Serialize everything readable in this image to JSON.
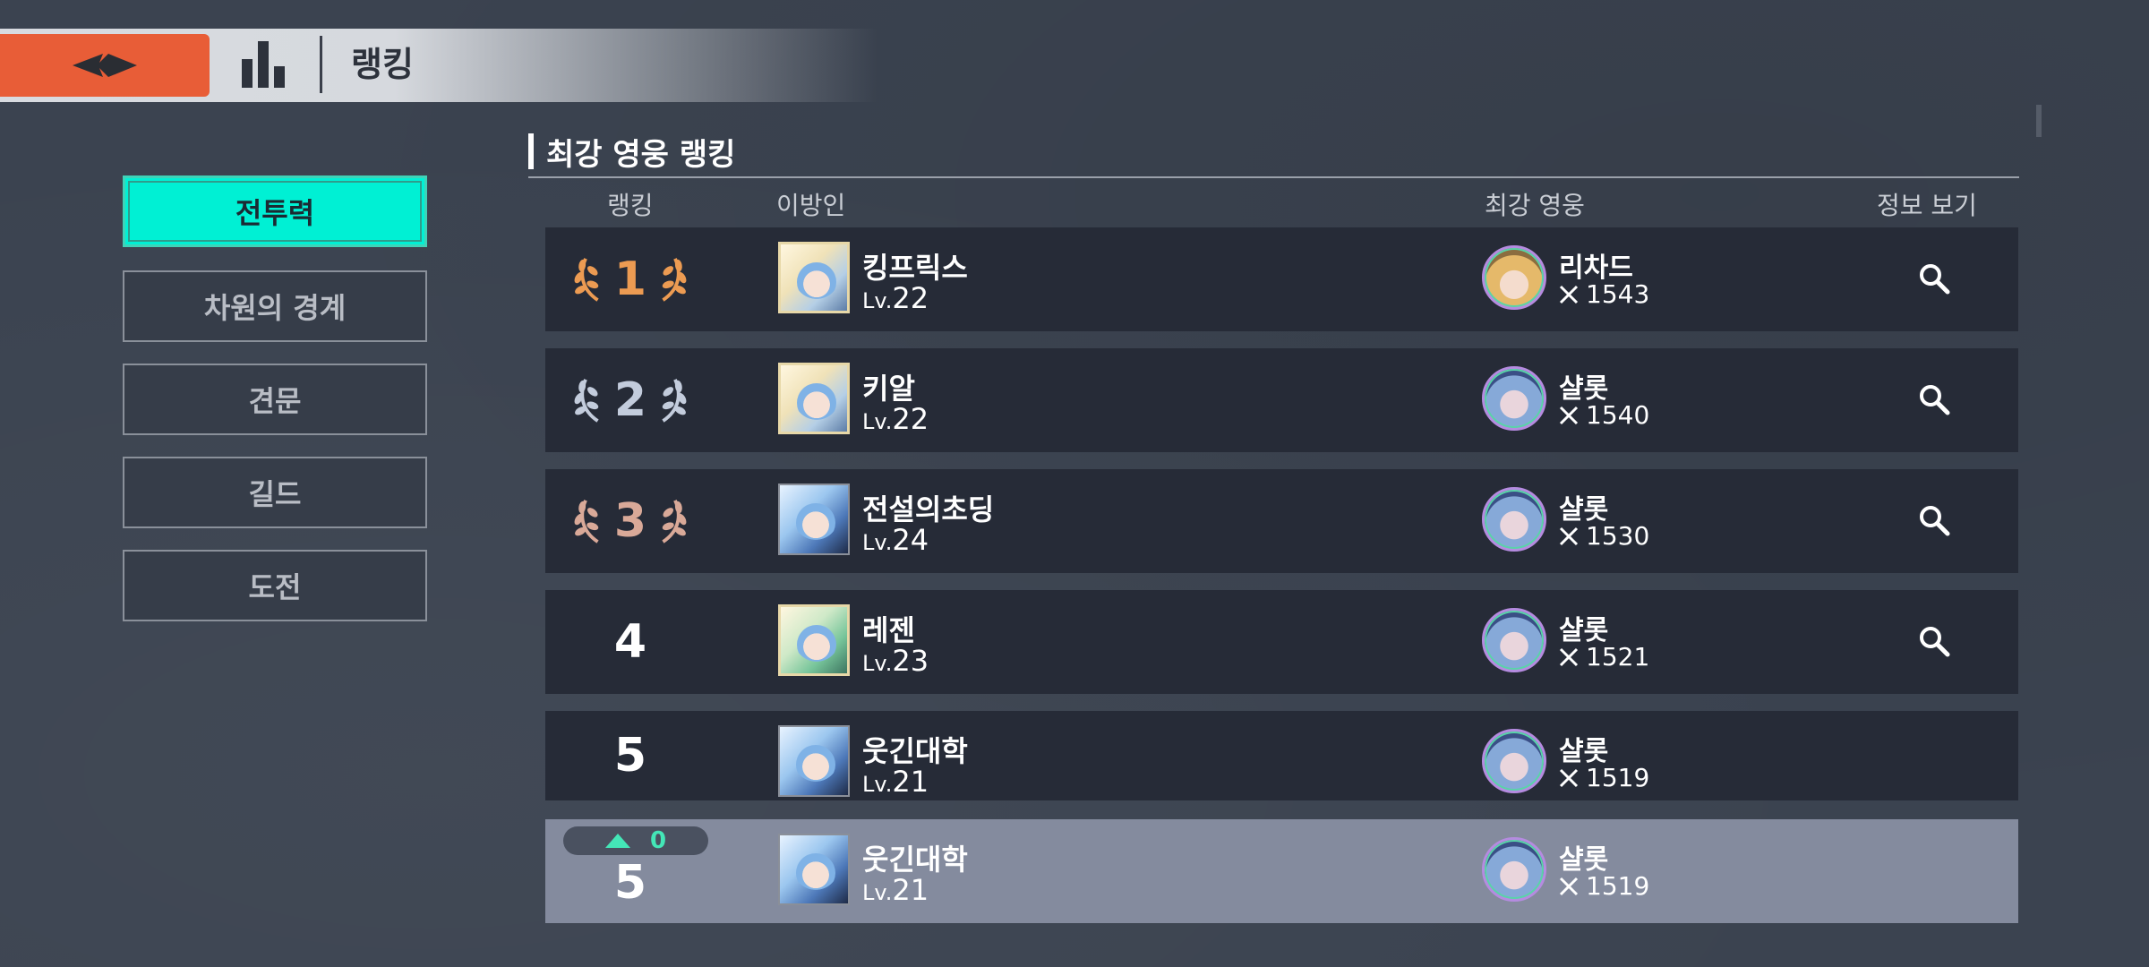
{
  "header": {
    "title": "랭킹",
    "back_icon": "back-arrow-icon",
    "ranking_icon": "bar-chart-icon",
    "accent_color": "#e85d37"
  },
  "sidebar": {
    "items": [
      {
        "label": "전투력",
        "active": true
      },
      {
        "label": "차원의 경계",
        "active": false
      },
      {
        "label": "견문",
        "active": false
      },
      {
        "label": "길드",
        "active": false
      },
      {
        "label": "도전",
        "active": false
      }
    ],
    "active_color": "#00f0d4"
  },
  "section": {
    "title": "최강 영웅 랭킹",
    "columns": {
      "rank": "랭킹",
      "player": "이방인",
      "hero": "최강 영웅",
      "info": "정보 보기"
    }
  },
  "rows": [
    {
      "rank": "1",
      "medal": "gold",
      "name": "킹프릭스",
      "lv_prefix": "Lv.",
      "lv": "22",
      "hero": "리차드",
      "power": "1543",
      "info_icon": "search-icon"
    },
    {
      "rank": "2",
      "medal": "silver",
      "name": "키알",
      "lv_prefix": "Lv.",
      "lv": "22",
      "hero": "샬롯",
      "power": "1540",
      "info_icon": "search-icon"
    },
    {
      "rank": "3",
      "medal": "bronze",
      "name": "전설의초딩",
      "lv_prefix": "Lv.",
      "lv": "24",
      "hero": "샬롯",
      "power": "1530",
      "info_icon": "search-icon"
    },
    {
      "rank": "4",
      "name": "레젠",
      "lv_prefix": "Lv.",
      "lv": "23",
      "hero": "샬롯",
      "power": "1521",
      "info_icon": "search-icon"
    },
    {
      "rank": "5",
      "name": "웃긴대학",
      "lv_prefix": "Lv.",
      "lv": "21",
      "hero": "샬롯",
      "power": "1519"
    }
  ],
  "my_row": {
    "rank_change": "0",
    "rank": "5",
    "name": "웃긴대학",
    "lv_prefix": "Lv.",
    "lv": "21",
    "hero": "샬롯",
    "power": "1519"
  }
}
